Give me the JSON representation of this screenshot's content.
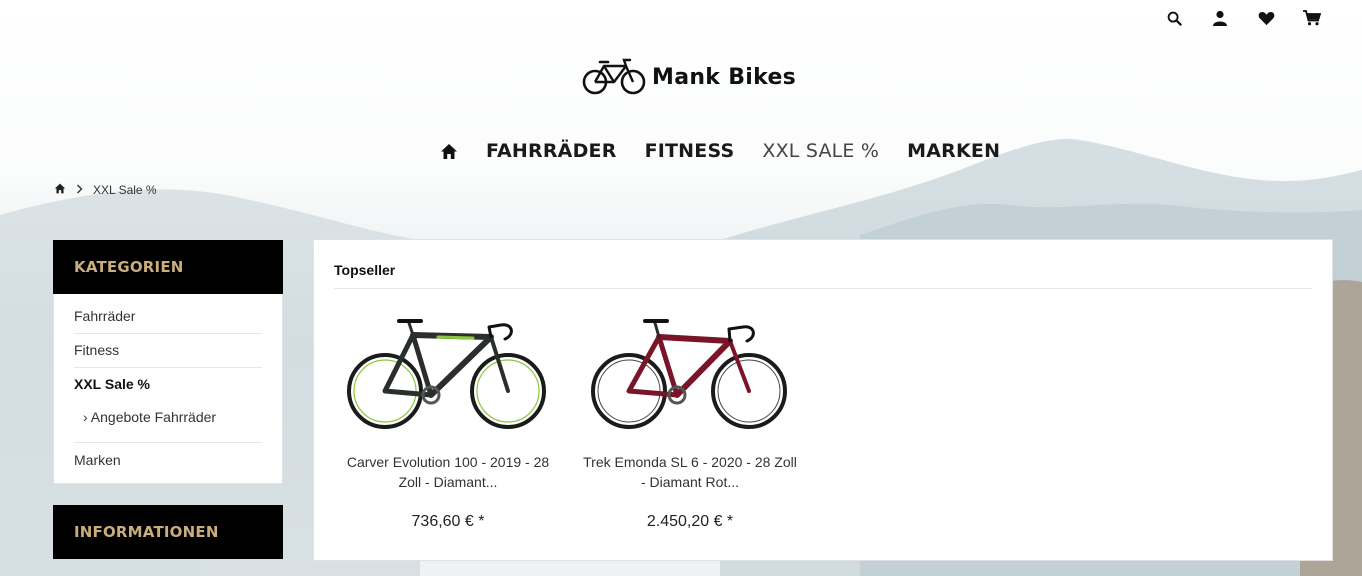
{
  "header": {
    "icons": [
      "search-icon",
      "account-icon",
      "wishlist-icon",
      "cart-icon"
    ],
    "logo_text": "Mank Bikes"
  },
  "nav": {
    "items": [
      {
        "label": "FAHRRÄDER",
        "active": false
      },
      {
        "label": "FITNESS",
        "active": false
      },
      {
        "label": "XXL SALE %",
        "active": true
      },
      {
        "label": "MARKEN",
        "active": false
      }
    ]
  },
  "breadcrumb": {
    "current": "XXL Sale %"
  },
  "sidebar": {
    "categories_title": "KATEGORIEN",
    "items": [
      {
        "label": "Fahrräder"
      },
      {
        "label": "Fitness"
      },
      {
        "label": "XXL Sale %"
      },
      {
        "label": "› Angebote Fahrräder"
      },
      {
        "label": "Marken"
      }
    ],
    "info_title": "INFORMATIONEN"
  },
  "main": {
    "section_title": "Topseller",
    "products": [
      {
        "name": "Carver Evolution 100 - 2019 - 28 Zoll - Diamant...",
        "price": "736,60 € *",
        "frame_color": "#2b2f2c",
        "accent_color": "#8cc63f"
      },
      {
        "name": "Trek Emonda SL 6 - 2020 - 28 Zoll - Diamant Rot...",
        "price": "2.450,20 € *",
        "frame_color": "#7a1428",
        "accent_color": "#2a2a2a"
      }
    ]
  },
  "colors": {
    "sidebar_header_bg": "#000000",
    "sidebar_header_text": "#c9ad7b"
  }
}
